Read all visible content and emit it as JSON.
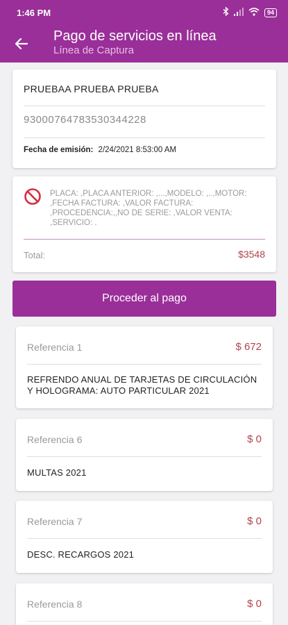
{
  "status_bar": {
    "time": "1:46 PM",
    "battery": "94"
  },
  "header": {
    "title": "Pago de servicios en línea",
    "subtitle": "Línea de Captura"
  },
  "holder": {
    "name": "PRUEBAA PRUEBA PRUEBA",
    "capture_line": "93000764783530344228",
    "emission_label": "Fecha de emisión:",
    "emission_value": "2/24/2021 8:53:00 AM"
  },
  "detail": {
    "text": "PLACA: ,PLACA ANTERIOR: ,...,MODELO: ,..,MOTOR: ,FECHA FACTURA: ,VALOR FACTURA: ,PROCEDENCIA:,,NO DE SERIE: ,VALOR VENTA: ,SERVICIO: .",
    "total_label": "Total:",
    "total_amount": "$3548"
  },
  "pay_button": "Proceder al pago",
  "references": [
    {
      "label": "Referencia 1",
      "amount": "$ 672",
      "description": "REFRENDO ANUAL DE TARJETAS DE CIRCULACIÓN Y HOLOGRAMA: AUTO PARTICULAR 2021"
    },
    {
      "label": "Referencia 6",
      "amount": "$ 0",
      "description": "MULTAS 2021"
    },
    {
      "label": "Referencia 7",
      "amount": "$ 0",
      "description": "DESC. RECARGOS 2021"
    },
    {
      "label": "Referencia 8",
      "amount": "$ 0",
      "description": ""
    }
  ],
  "colors": {
    "brand": "#9a2f99",
    "amount": "#b1424f",
    "error": "#d32f3f"
  }
}
